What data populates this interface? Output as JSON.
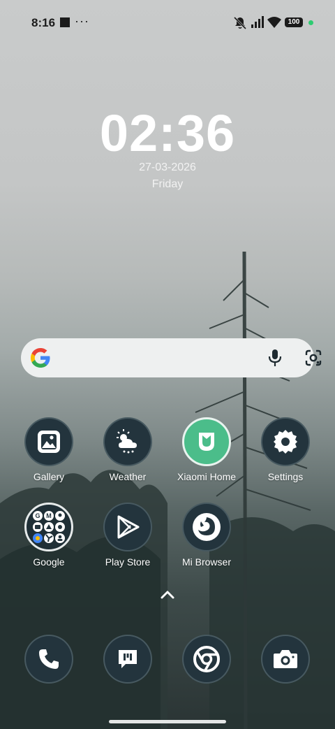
{
  "status_bar": {
    "time": "8:16",
    "battery": "100",
    "more": "···"
  },
  "clock": {
    "time": "02:36",
    "date": "27-03-2026",
    "day": "Friday"
  },
  "search": {
    "logo": "google-logo",
    "mic_icon": "mic-icon",
    "lens_icon": "lens-icon"
  },
  "apps_row1": [
    {
      "label": "Gallery",
      "icon": "gallery-icon"
    },
    {
      "label": "Weather",
      "icon": "weather-icon"
    },
    {
      "label": "Xiaomi Home",
      "icon": "xiaomi-home-icon"
    },
    {
      "label": "Settings",
      "icon": "settings-icon"
    }
  ],
  "apps_row2": [
    {
      "label": "Google",
      "icon": "google-folder-icon"
    },
    {
      "label": "Play Store",
      "icon": "play-store-icon"
    },
    {
      "label": "Mi Browser",
      "icon": "mi-browser-icon"
    }
  ],
  "dock": [
    {
      "icon": "phone-icon"
    },
    {
      "icon": "messages-icon"
    },
    {
      "icon": "chrome-icon"
    },
    {
      "icon": "camera-icon"
    }
  ],
  "colors": {
    "icon_bg": "#23343d",
    "xiaomi_green": "#4bbd8a"
  }
}
